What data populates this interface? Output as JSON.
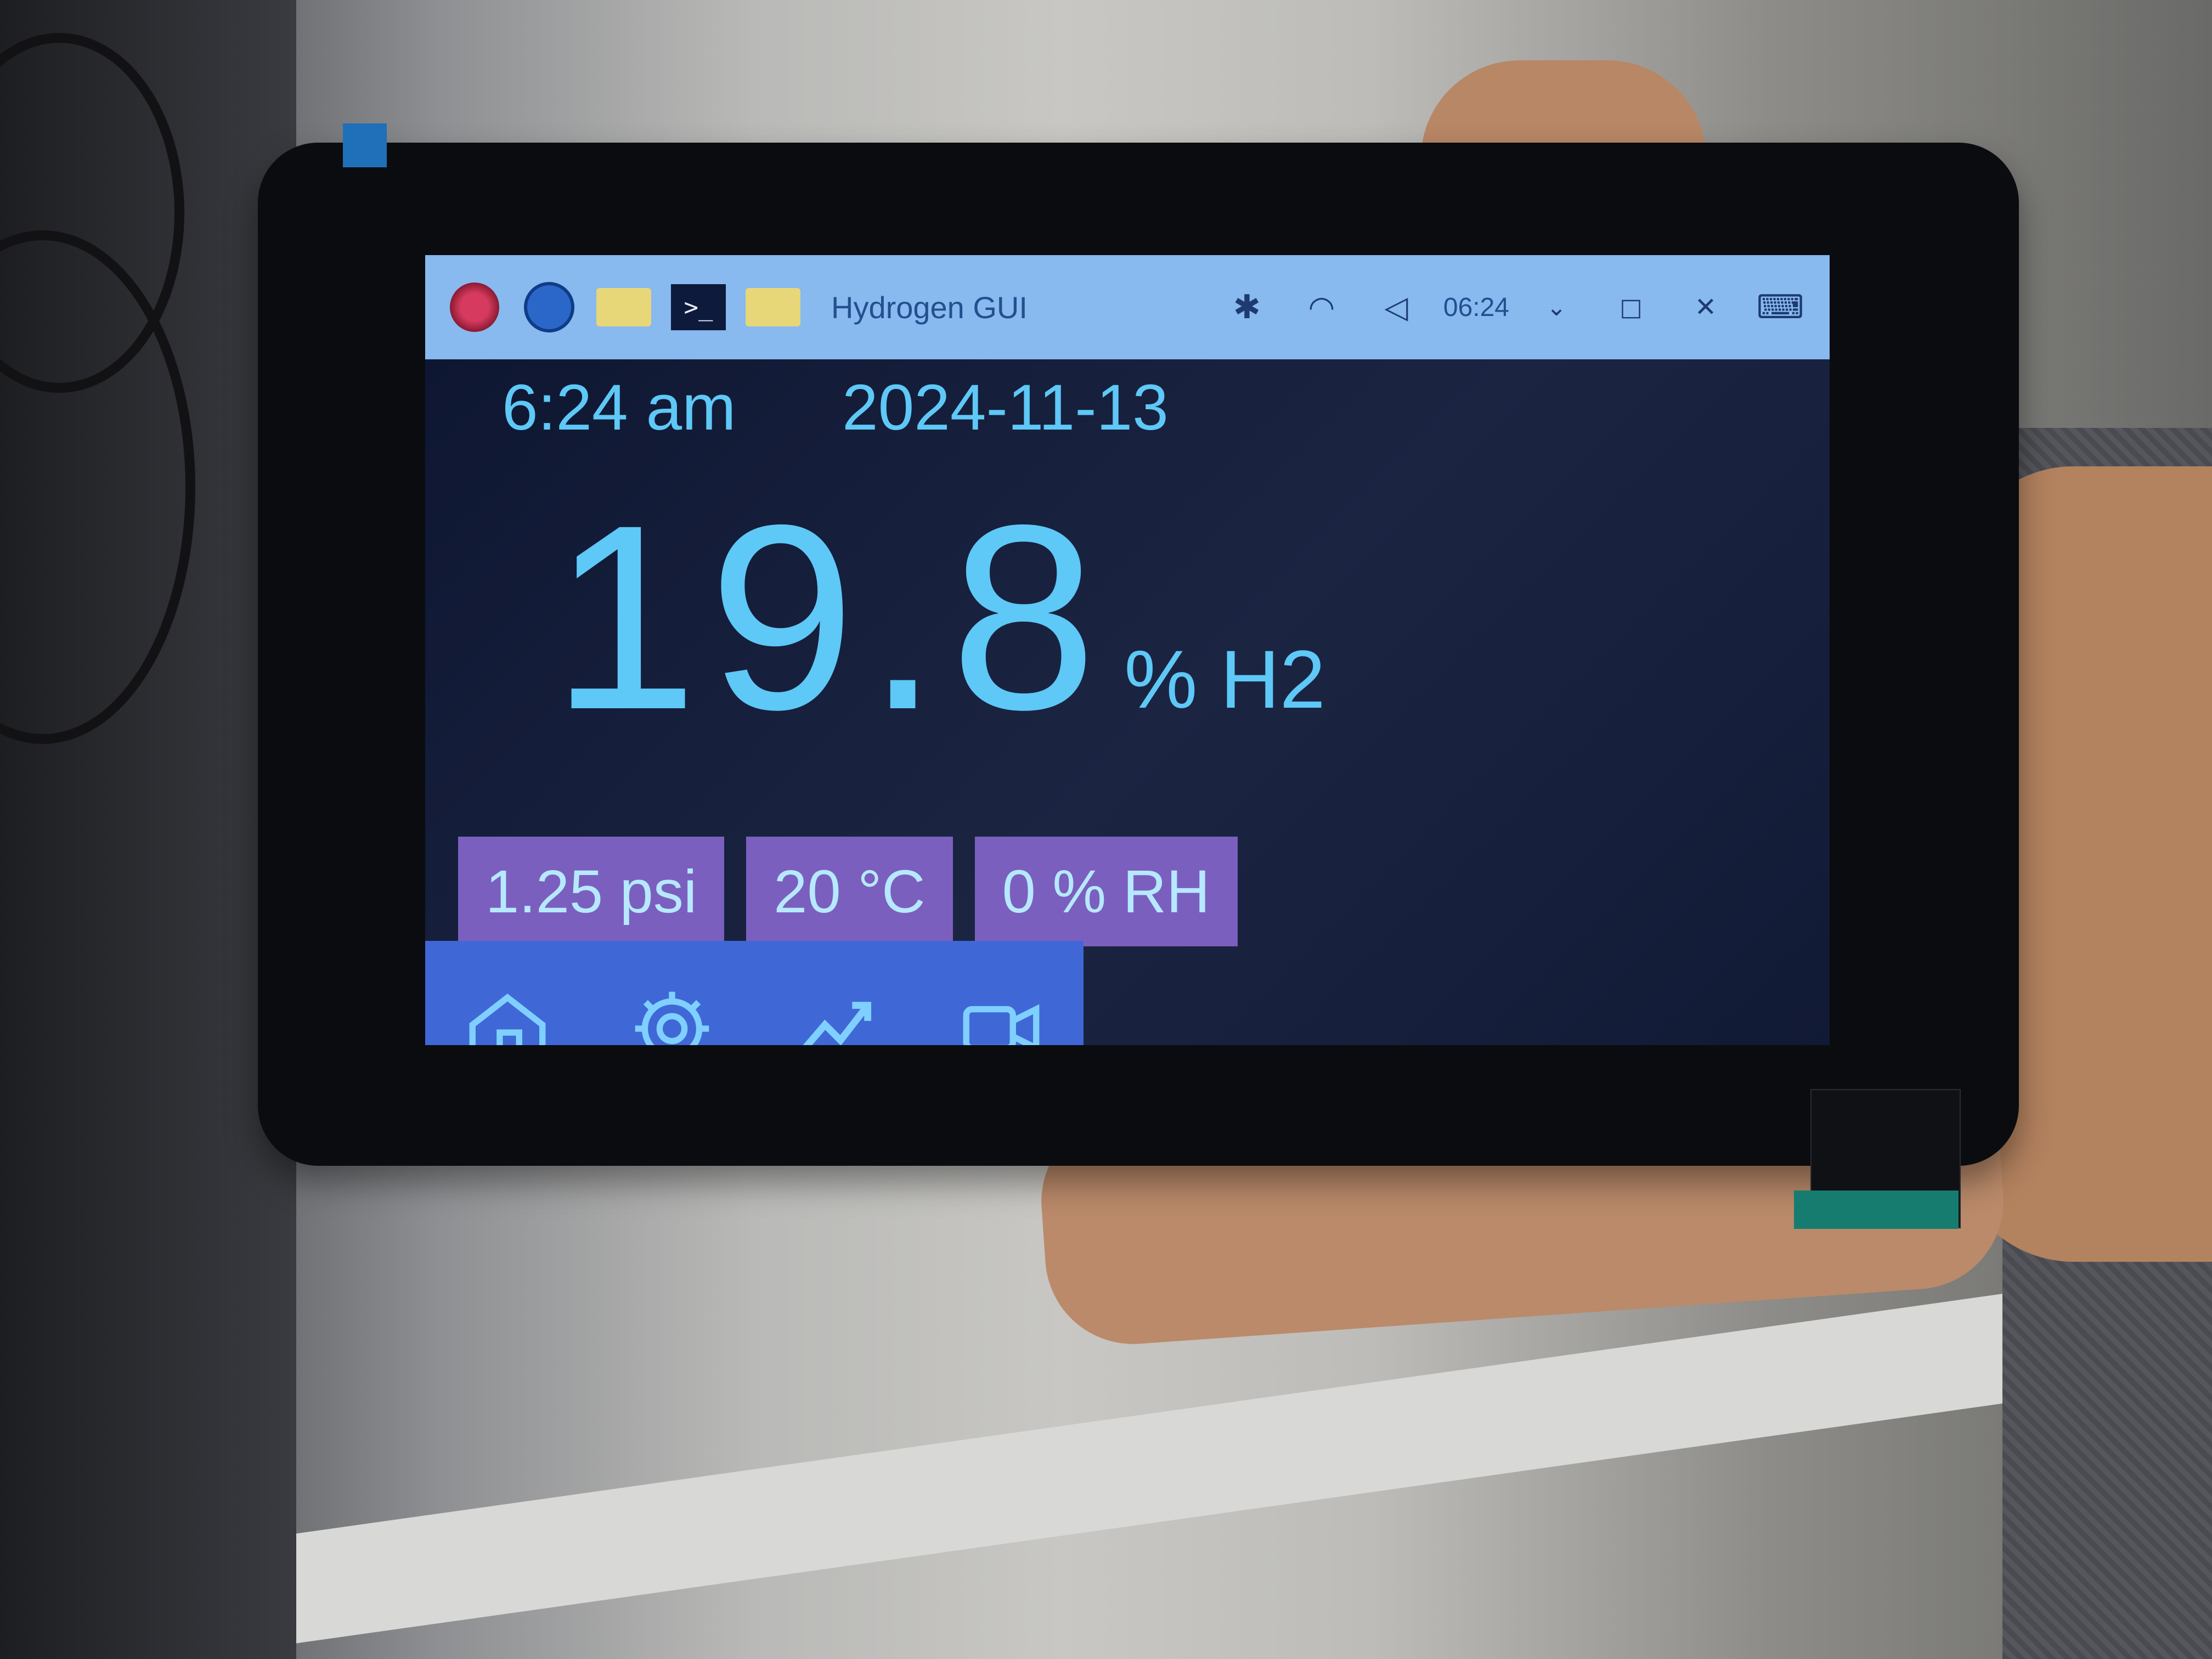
{
  "window_title": "Hydrogen GUI",
  "taskbar_clock": "06:24",
  "taskbar_icons": [
    "raspberry-pi-menu-icon",
    "web-browser-icon",
    "file-manager-icon",
    "terminal-icon",
    "folder-icon"
  ],
  "status_icons": [
    "bluetooth-icon",
    "wifi-icon",
    "volume-icon"
  ],
  "time": "6:24 am",
  "date": "2024-11-13",
  "reading": {
    "value": "19.8",
    "unit": "% H2"
  },
  "metrics": [
    {
      "label": "1.25 psi"
    },
    {
      "label": "20 °C"
    },
    {
      "label": "0 % RH"
    }
  ],
  "nav": [
    "home-icon",
    "settings-icon",
    "chart-icon",
    "camera-icon"
  ],
  "colors": {
    "accent_text": "#5ec8f7",
    "metric_bg": "#7b5fbf",
    "nav_bg": "#3f68d6",
    "taskbar_bg": "#88b9ef"
  }
}
